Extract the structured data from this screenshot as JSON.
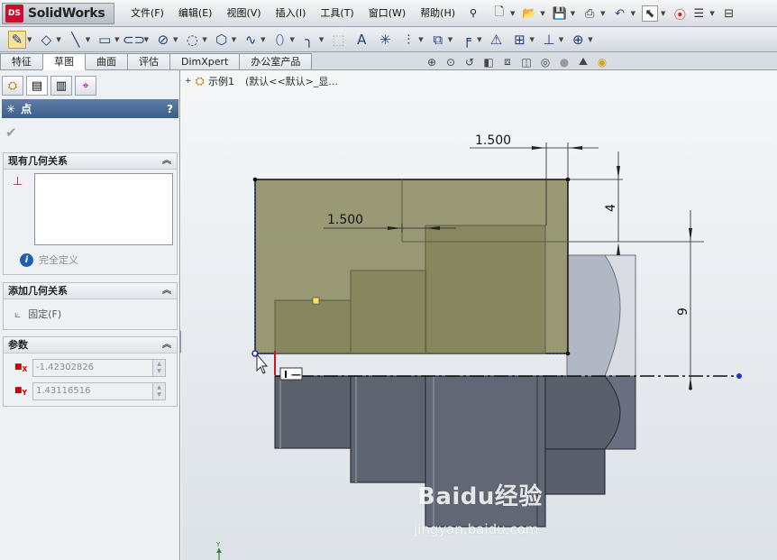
{
  "app": {
    "brand": "SolidWorks",
    "logo_mark": "DS"
  },
  "menus": [
    "文件(F)",
    "编辑(E)",
    "视图(V)",
    "插入(I)",
    "工具(T)",
    "窗口(W)",
    "帮助(H)"
  ],
  "title_tools": [
    "new-icon",
    "open-icon",
    "save-icon",
    "print-icon",
    "undo-icon",
    "select-icon",
    "traffic-light-icon",
    "options-icon",
    "rebuild-icon"
  ],
  "sketch_tools": [
    "sketch-icon",
    "smart-dimension-icon",
    "line-icon",
    "rectangle-icon",
    "slot-icon",
    "circle-icon",
    "arc-icon",
    "polygon-icon",
    "spline-icon",
    "ellipse-icon",
    "fillet-icon",
    "text-icon",
    "point-icon",
    "centerline-icon",
    "mirror-icon",
    "offset-icon",
    "trim-icon",
    "pattern-icon",
    "relations-icon",
    "repair-icon",
    "quick-snap-icon"
  ],
  "tabs": [
    {
      "label": "特征",
      "active": false
    },
    {
      "label": "草图",
      "active": true
    },
    {
      "label": "曲面",
      "active": false
    },
    {
      "label": "评估",
      "active": false
    },
    {
      "label": "DimXpert",
      "active": false
    },
    {
      "label": "办公室产品",
      "active": false
    }
  ],
  "property_manager": {
    "title": "点",
    "help": "?",
    "ok_icon": "check-icon",
    "existing_relations": {
      "header": "现有几何关系",
      "status": "完全定义",
      "status_icon": "info-icon"
    },
    "add_relations": {
      "header": "添加几何关系",
      "fix_label": "固定(F)"
    },
    "parameters": {
      "header": "参数",
      "x_label": "X",
      "x_value": "-1.42302826",
      "y_label": "Y",
      "y_value": "1.43116516"
    }
  },
  "tree_flyout": {
    "part": "示例1",
    "configuration": "(默认<<默认>_显..."
  },
  "dimensions": {
    "top": "1.500",
    "middle": "1.500",
    "vertical_small": "4",
    "vertical_large": "9"
  },
  "watermark": {
    "brand": "Baidu经验",
    "url": "jingyan.baidu.com"
  },
  "colors": {
    "sketch_fill": "#8a8a5e",
    "part_dark": "#5a5f6c",
    "part_light": "#b4b9c6",
    "accent_blue": "#3d5d8a"
  }
}
